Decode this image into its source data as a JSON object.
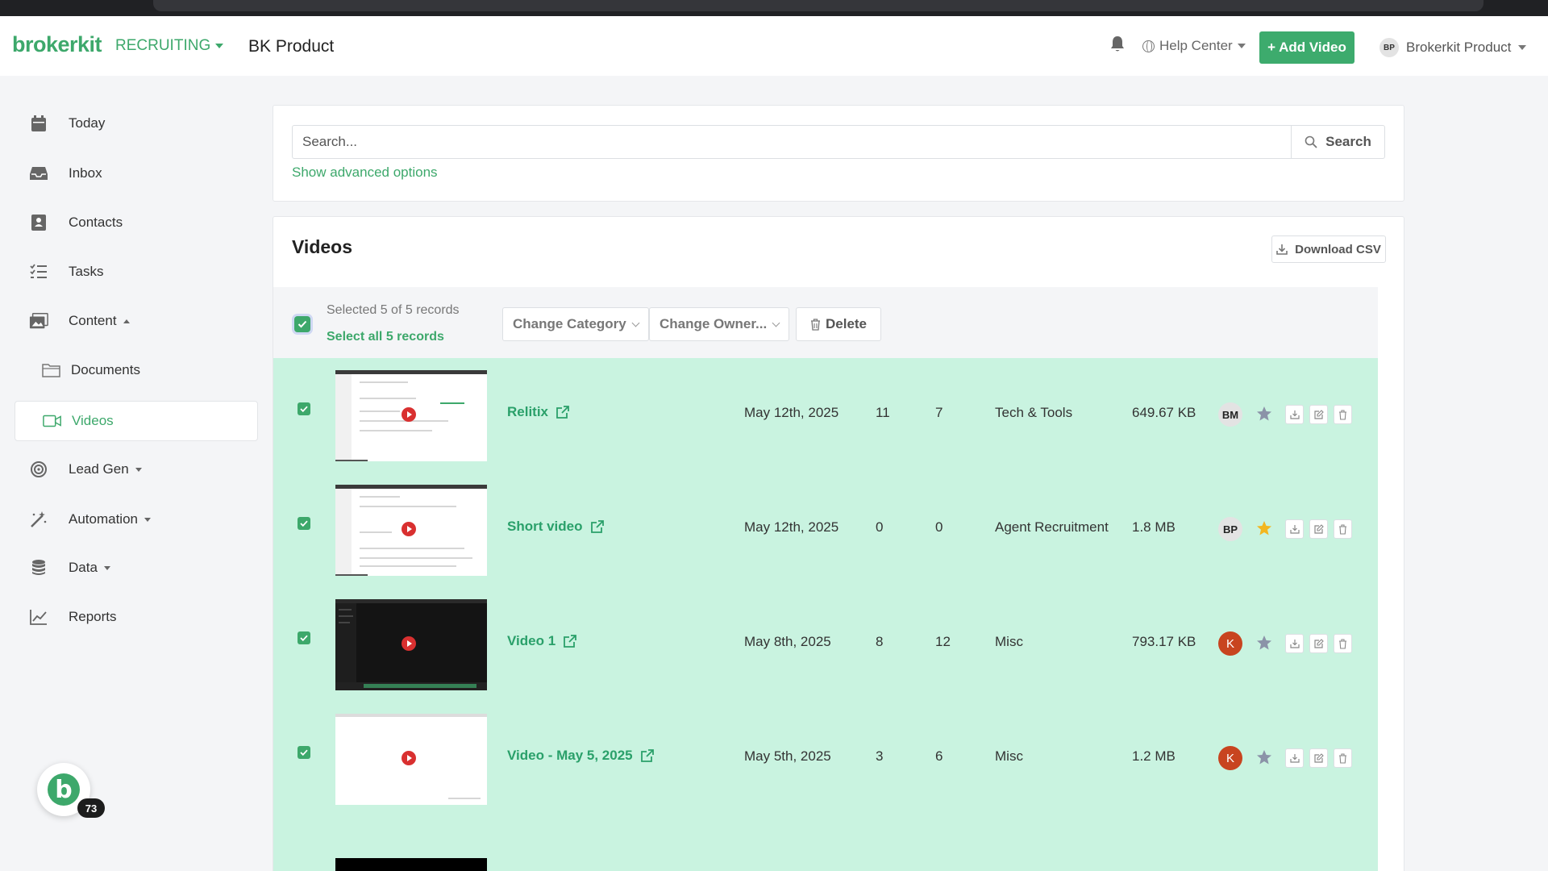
{
  "header": {
    "logo": "brokerkit",
    "module": "RECRUITING",
    "workspace": "BK Product",
    "help_center": "Help Center",
    "add_video": "+ Add Video",
    "user_initials": "BP",
    "user_name": "Brokerkit Product"
  },
  "sidebar": {
    "items": [
      {
        "label": "Today",
        "icon": "calendar-icon"
      },
      {
        "label": "Inbox",
        "icon": "inbox-icon"
      },
      {
        "label": "Contacts",
        "icon": "contacts-icon"
      },
      {
        "label": "Tasks",
        "icon": "tasks-icon"
      },
      {
        "label": "Content",
        "icon": "content-icon"
      },
      {
        "label": "Documents",
        "icon": "folder-icon"
      },
      {
        "label": "Videos",
        "icon": "video-icon"
      },
      {
        "label": "Lead Gen",
        "icon": "leadgen-icon"
      },
      {
        "label": "Automation",
        "icon": "magic-wand-icon"
      },
      {
        "label": "Data",
        "icon": "database-icon"
      },
      {
        "label": "Reports",
        "icon": "chart-icon"
      }
    ],
    "active": "Videos",
    "bubble_letter": "b",
    "bubble_count": "73"
  },
  "search": {
    "placeholder": "Search...",
    "button": "Search",
    "advanced": "Show advanced options"
  },
  "videos": {
    "title": "Videos",
    "download_csv": "Download CSV",
    "bulk": {
      "selected_text": "Selected 5 of 5 records",
      "select_all": "Select all 5 records",
      "change_category": "Change Category",
      "change_owner": "Change Owner...",
      "delete": "Delete"
    },
    "rows": [
      {
        "title": "Relitix",
        "date": "May 12th, 2025",
        "stat_a": "11",
        "stat_b": "7",
        "category": "Tech & Tools",
        "size": "649.67 KB",
        "owner": "BM",
        "starred": false
      },
      {
        "title": "Short video",
        "date": "May 12th, 2025",
        "stat_a": "0",
        "stat_b": "0",
        "category": "Agent Recruitment",
        "size": "1.8 MB",
        "owner": "BP",
        "starred": true
      },
      {
        "title": "Video 1",
        "date": "May 8th, 2025",
        "stat_a": "8",
        "stat_b": "12",
        "category": "Misc",
        "size": "793.17 KB",
        "owner": "K",
        "starred": false
      },
      {
        "title": "Video - May 5, 2025",
        "date": "May 5th, 2025",
        "stat_a": "3",
        "stat_b": "6",
        "category": "Misc",
        "size": "1.2 MB",
        "owner": "K",
        "starred": false
      }
    ]
  },
  "colors": {
    "brand_green": "#3da86b",
    "row_highlight": "#c9f3e0",
    "star_active": "#f3b61f",
    "avatar_red": "#c8441f"
  }
}
